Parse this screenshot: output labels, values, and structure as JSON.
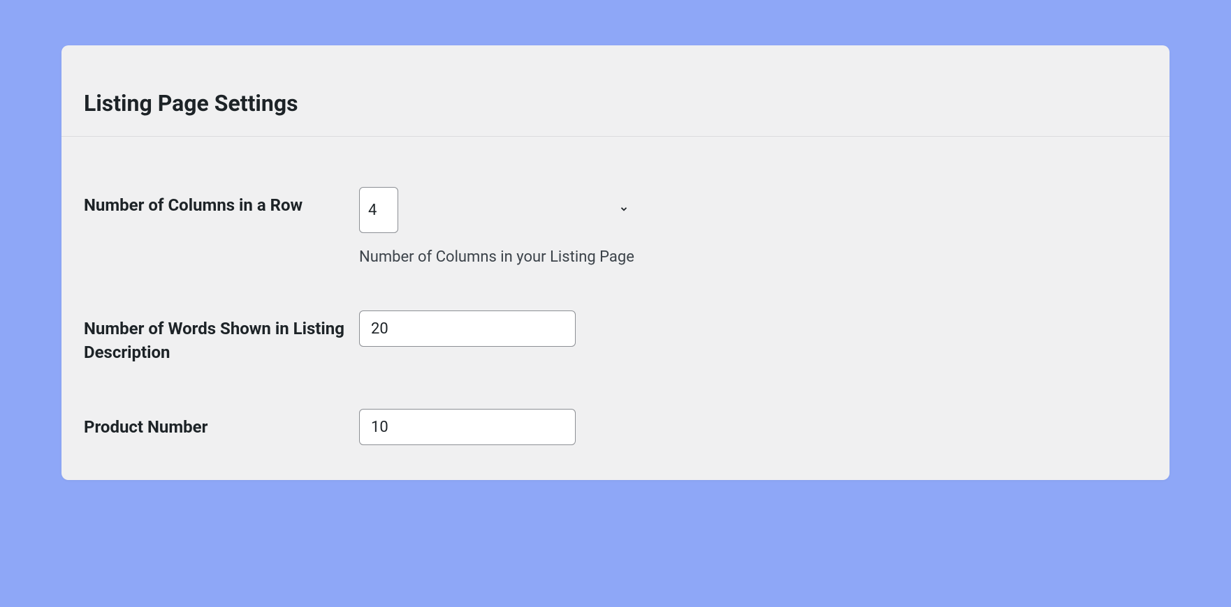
{
  "panel": {
    "title": "Listing Page Settings"
  },
  "fields": {
    "columns": {
      "label": "Number of Columns in a Row",
      "value": "4",
      "help": "Number of Columns in your Listing Page"
    },
    "words": {
      "label": "Number of Words Shown in Listing Description",
      "value": "20"
    },
    "product_number": {
      "label": "Product Number",
      "value": "10"
    }
  }
}
